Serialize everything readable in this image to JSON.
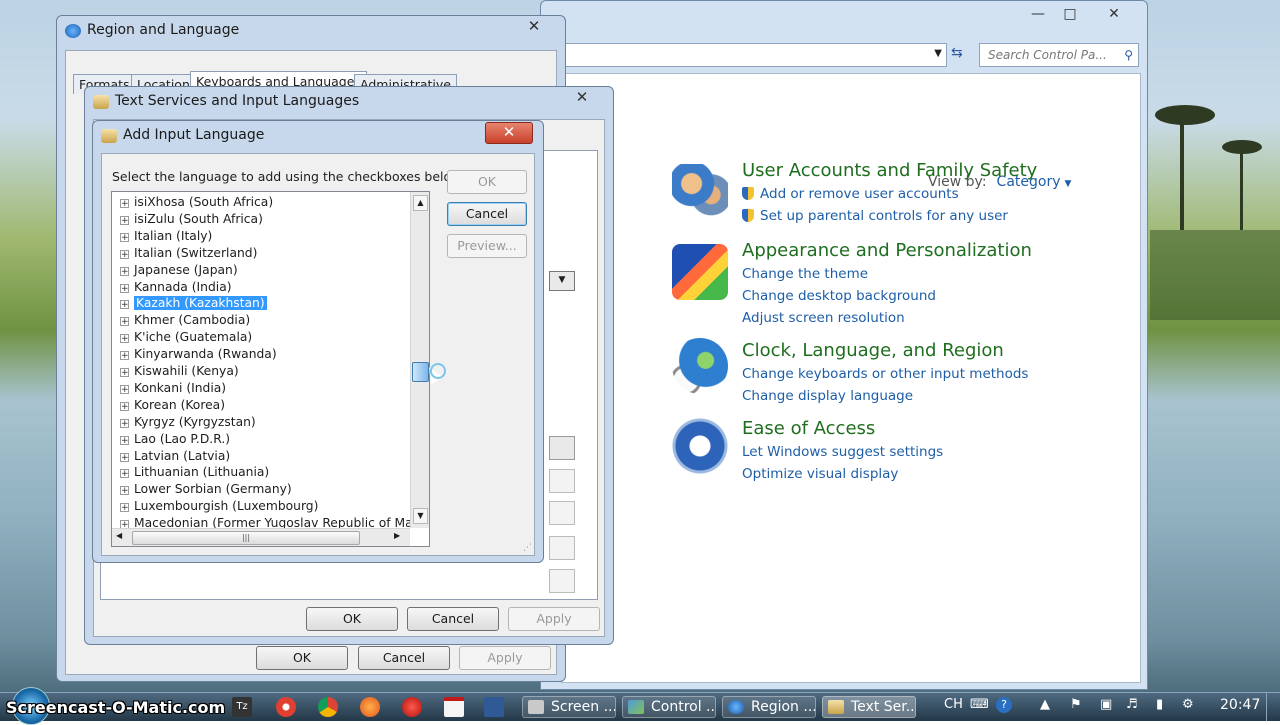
{
  "control_panel": {
    "search_placeholder": "Search Control Pa...",
    "view_by_label": "View by:",
    "view_by_value": "Category",
    "categories": [
      {
        "heading": "User Accounts and Family Safety",
        "links": [
          "Add or remove user accounts",
          "Set up parental controls for any user"
        ]
      },
      {
        "heading": "Appearance and Personalization",
        "links": [
          "Change the theme",
          "Change desktop background",
          "Adjust screen resolution"
        ]
      },
      {
        "heading": "Clock, Language, and Region",
        "links": [
          "Change keyboards or other input methods",
          "Change display language"
        ]
      },
      {
        "heading": "Ease of Access",
        "links": [
          "Let Windows suggest settings",
          "Optimize visual display"
        ]
      }
    ]
  },
  "region_dialog": {
    "title": "Region and Language",
    "tabs": [
      "Formats",
      "Location",
      "Keyboards and Languages",
      "Administrative"
    ],
    "ok": "OK",
    "cancel": "Cancel",
    "apply": "Apply"
  },
  "text_services_dialog": {
    "title": "Text Services and Input Languages",
    "ok": "OK",
    "cancel": "Cancel",
    "apply": "Apply"
  },
  "add_language_dialog": {
    "title": "Add Input Language",
    "instruction": "Select the language to add using the checkboxes below.",
    "ok": "OK",
    "cancel": "Cancel",
    "preview": "Preview...",
    "selected": "Kazakh (Kazakhstan)",
    "languages": [
      "isiXhosa (South Africa)",
      "isiZulu (South Africa)",
      "Italian (Italy)",
      "Italian (Switzerland)",
      "Japanese (Japan)",
      "Kannada (India)",
      "Kazakh (Kazakhstan)",
      "Khmer (Cambodia)",
      "K'iche (Guatemala)",
      "Kinyarwanda (Rwanda)",
      "Kiswahili (Kenya)",
      "Konkani (India)",
      "Korean (Korea)",
      "Kyrgyz (Kyrgyzstan)",
      "Lao (Lao P.D.R.)",
      "Latvian (Latvia)",
      "Lithuanian (Lithuania)",
      "Lower Sorbian (Germany)",
      "Luxembourgish (Luxembourg)",
      "Macedonian (Former Yugoslav Republic of Macedonia)"
    ]
  },
  "taskbar": {
    "items": [
      "Screen ...",
      "Control ...",
      "Region ...",
      "Text Ser..."
    ],
    "language_indicator": "CH",
    "clock": "20:47"
  },
  "watermark": "Screencast-O-Matic.com"
}
